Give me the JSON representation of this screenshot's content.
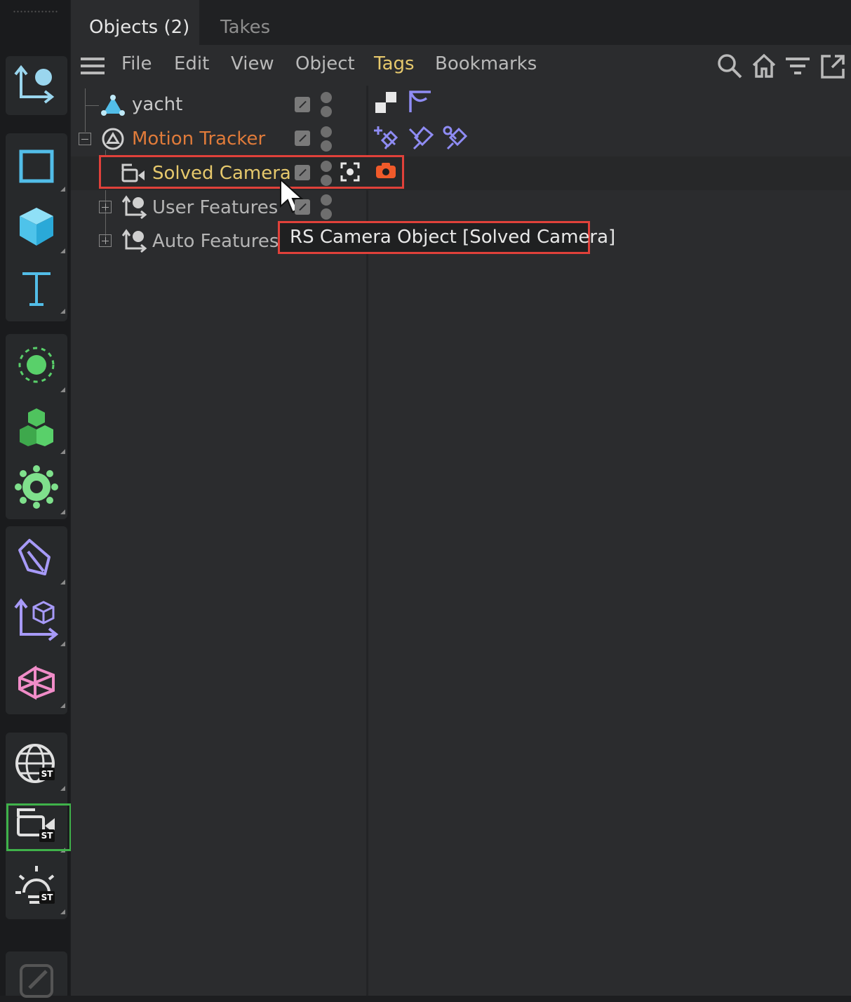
{
  "tabs": {
    "objects": "Objects (2)",
    "takes": "Takes"
  },
  "menu": {
    "file": "File",
    "edit": "Edit",
    "view": "View",
    "object": "Object",
    "tags": "Tags",
    "bookmarks": "Bookmarks"
  },
  "toolbar_icons": [
    "search-icon",
    "home-icon",
    "filter-icon",
    "new-window-icon"
  ],
  "tree": {
    "yacht": "yacht",
    "motion_tracker": "Motion Tracker",
    "solved_camera": "Solved Camera",
    "user_features": "User Features",
    "auto_features": "Auto Features"
  },
  "tooltip": "RS Camera Object [Solved Camera]",
  "palette_tools": [
    "null-object-icon",
    "cube-outline-icon",
    "cube-icon",
    "text-icon",
    "fields-icon",
    "cloner-icon",
    "deformer-icon",
    "spline-pen-icon",
    "generator-icon",
    "polygon-icon",
    "st-globe-icon",
    "st-camera-icon",
    "st-light-icon",
    "edit-icon"
  ],
  "colors": {
    "accent_selected": "#e6c86c",
    "active_object": "#e07b3a",
    "highlight_red": "#e0413a",
    "highlight_green": "#3fb24a",
    "tag_purple": "#8f8cf4"
  }
}
